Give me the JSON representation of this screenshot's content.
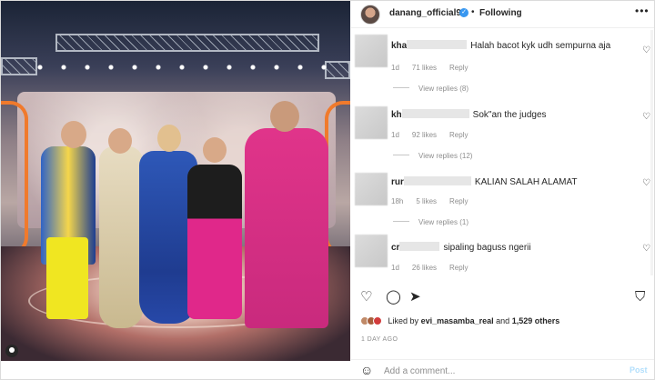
{
  "header": {
    "username": "danang_official91",
    "separator": "•",
    "following": "Following",
    "more": "•••"
  },
  "comments": [
    {
      "user_prefix": "kha",
      "text": "Halah bacot kyk udh sempurna aja",
      "age": "1d",
      "likes": "71 likes",
      "reply": "Reply",
      "view_replies": "View replies (8)"
    },
    {
      "user_prefix": "kh",
      "text": "Sok\"an the judges",
      "age": "1d",
      "likes": "92 likes",
      "reply": "Reply",
      "view_replies": "View replies (12)"
    },
    {
      "user_prefix": "rur",
      "text": "KALIAN SALAH ALAMAT",
      "age": "18h",
      "likes": "5 likes",
      "reply": "Reply",
      "view_replies": "View replies (1)"
    },
    {
      "user_prefix": "cr",
      "text": "sipaling baguss ngerii",
      "age": "1d",
      "likes": "26 likes",
      "reply": "Reply"
    }
  ],
  "likes": {
    "prefix": "Liked by",
    "user": "evi_masamba_real",
    "and": "and",
    "others": "1,529 others"
  },
  "date": "1 DAY AGO",
  "composer": {
    "placeholder": "Add a comment...",
    "post": "Post"
  },
  "icons": [
    "verified-icon",
    "more-icon",
    "heart-icon",
    "comment-icon",
    "share-icon",
    "bookmark-icon",
    "emoji-icon",
    "user-tag-icon"
  ],
  "colors": {
    "accent": "#3897f0",
    "post_disabled": "#b2dffc",
    "muted": "#8e8e8e"
  }
}
